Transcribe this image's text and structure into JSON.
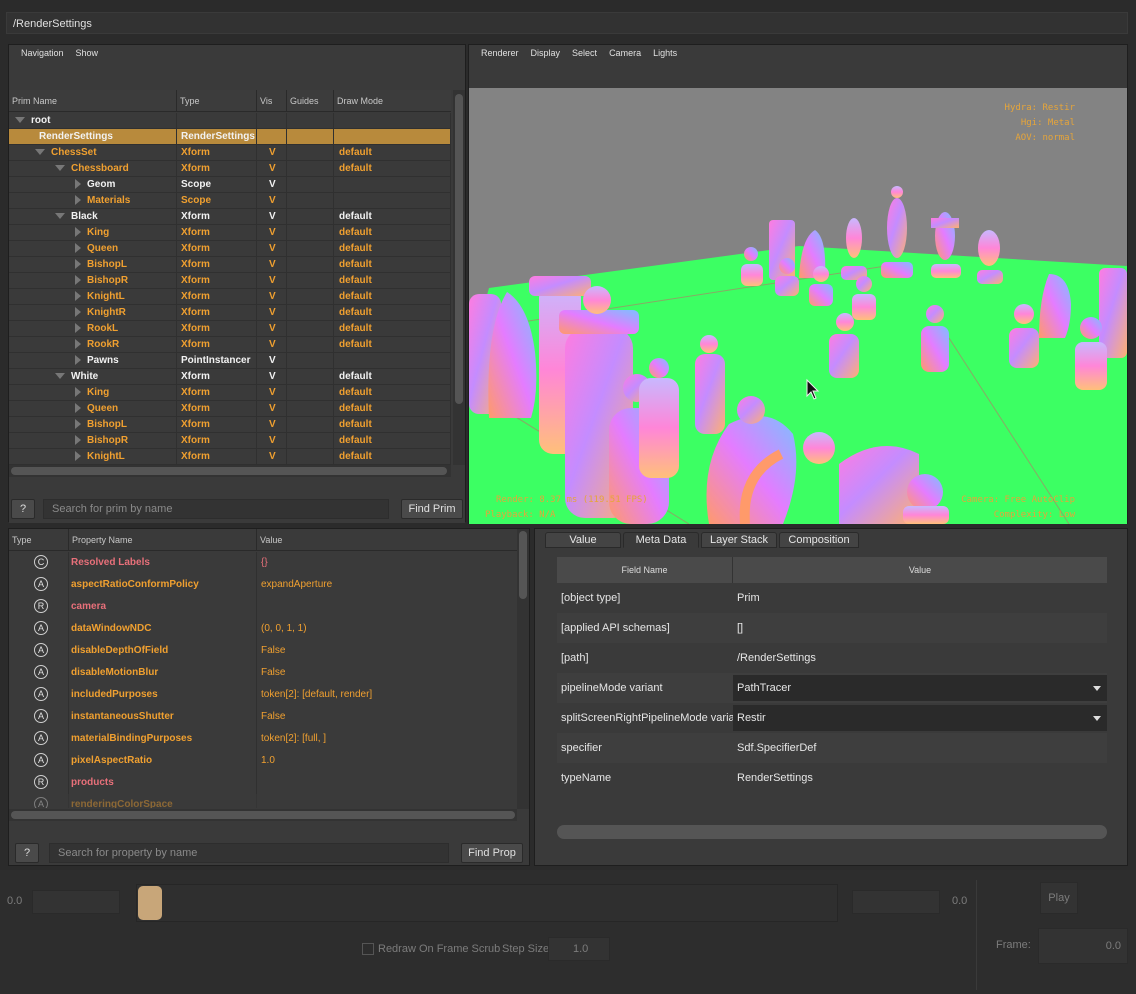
{
  "path": "/RenderSettings",
  "prim_panel": {
    "menu": [
      "Navigation",
      "Show"
    ],
    "columns": [
      "Prim Name",
      "Type",
      "Vis",
      "Guides",
      "Draw Mode"
    ],
    "rows": [
      {
        "name": "root",
        "type": "",
        "vis": "",
        "draw": "",
        "indent": 0,
        "expander": "down",
        "color": "white",
        "selected": false
      },
      {
        "name": "RenderSettings",
        "type": "RenderSettings",
        "vis": "",
        "draw": "",
        "indent": 1,
        "expander": "none",
        "color": "white",
        "selected": true
      },
      {
        "name": "ChessSet",
        "type": "Xform",
        "vis": "V",
        "draw": "default",
        "indent": 1,
        "expander": "down",
        "color": "orange",
        "selected": false
      },
      {
        "name": "Chessboard",
        "type": "Xform",
        "vis": "V",
        "draw": "default",
        "indent": 2,
        "expander": "down",
        "color": "orange",
        "selected": false
      },
      {
        "name": "Geom",
        "type": "Scope",
        "vis": "V",
        "draw": "",
        "indent": 3,
        "expander": "right",
        "color": "white",
        "selected": false
      },
      {
        "name": "Materials",
        "type": "Scope",
        "vis": "V",
        "draw": "",
        "indent": 3,
        "expander": "right",
        "color": "orange",
        "selected": false
      },
      {
        "name": "Black",
        "type": "Xform",
        "vis": "V",
        "draw": "default",
        "indent": 2,
        "expander": "down",
        "color": "white",
        "selected": false
      },
      {
        "name": "King",
        "type": "Xform",
        "vis": "V",
        "draw": "default",
        "indent": 3,
        "expander": "right",
        "color": "orange",
        "selected": false
      },
      {
        "name": "Queen",
        "type": "Xform",
        "vis": "V",
        "draw": "default",
        "indent": 3,
        "expander": "right",
        "color": "orange",
        "selected": false
      },
      {
        "name": "BishopL",
        "type": "Xform",
        "vis": "V",
        "draw": "default",
        "indent": 3,
        "expander": "right",
        "color": "orange",
        "selected": false
      },
      {
        "name": "BishopR",
        "type": "Xform",
        "vis": "V",
        "draw": "default",
        "indent": 3,
        "expander": "right",
        "color": "orange",
        "selected": false
      },
      {
        "name": "KnightL",
        "type": "Xform",
        "vis": "V",
        "draw": "default",
        "indent": 3,
        "expander": "right",
        "color": "orange",
        "selected": false
      },
      {
        "name": "KnightR",
        "type": "Xform",
        "vis": "V",
        "draw": "default",
        "indent": 3,
        "expander": "right",
        "color": "orange",
        "selected": false
      },
      {
        "name": "RookL",
        "type": "Xform",
        "vis": "V",
        "draw": "default",
        "indent": 3,
        "expander": "right",
        "color": "orange",
        "selected": false
      },
      {
        "name": "RookR",
        "type": "Xform",
        "vis": "V",
        "draw": "default",
        "indent": 3,
        "expander": "right",
        "color": "orange",
        "selected": false
      },
      {
        "name": "Pawns",
        "type": "PointInstancer",
        "vis": "V",
        "draw": "",
        "indent": 3,
        "expander": "right",
        "color": "white",
        "selected": false
      },
      {
        "name": "White",
        "type": "Xform",
        "vis": "V",
        "draw": "default",
        "indent": 2,
        "expander": "down",
        "color": "white",
        "selected": false
      },
      {
        "name": "King",
        "type": "Xform",
        "vis": "V",
        "draw": "default",
        "indent": 3,
        "expander": "right",
        "color": "orange",
        "selected": false
      },
      {
        "name": "Queen",
        "type": "Xform",
        "vis": "V",
        "draw": "default",
        "indent": 3,
        "expander": "right",
        "color": "orange",
        "selected": false
      },
      {
        "name": "BishopL",
        "type": "Xform",
        "vis": "V",
        "draw": "default",
        "indent": 3,
        "expander": "right",
        "color": "orange",
        "selected": false
      },
      {
        "name": "BishopR",
        "type": "Xform",
        "vis": "V",
        "draw": "default",
        "indent": 3,
        "expander": "right",
        "color": "orange",
        "selected": false
      },
      {
        "name": "KnightL",
        "type": "Xform",
        "vis": "V",
        "draw": "default",
        "indent": 3,
        "expander": "right",
        "color": "orange",
        "selected": false
      }
    ],
    "search_placeholder": "Search for prim by name",
    "help_label": "?",
    "find_label": "Find Prim"
  },
  "viewport": {
    "menu": [
      "Renderer",
      "Display",
      "Select",
      "Camera",
      "Lights"
    ],
    "hud_top_right": [
      "Hydra: Restir",
      "Hgi: Metal",
      "AOV: normal"
    ],
    "hud_bottom_left": [
      "Render: 8.37 ms (119.51 FPS)",
      "Playback: N/A"
    ],
    "hud_bottom_right": [
      "Camera: Free AutoClip",
      "Complexity: Low"
    ],
    "colors": {
      "background": "#838383",
      "board": "#3cff63",
      "hud": "#e6a53a"
    }
  },
  "property_panel": {
    "columns": [
      "Type",
      "Property Name",
      "Value"
    ],
    "rows": [
      {
        "icon": "C",
        "name": "Resolved Labels",
        "value": "{}",
        "color": "pink"
      },
      {
        "icon": "A",
        "name": "aspectRatioConformPolicy",
        "value": "expandAperture",
        "color": "orange"
      },
      {
        "icon": "R",
        "name": "camera",
        "value": "",
        "color": "pink"
      },
      {
        "icon": "A",
        "name": "dataWindowNDC",
        "value": "(0, 0, 1, 1)",
        "color": "orange"
      },
      {
        "icon": "A",
        "name": "disableDepthOfField",
        "value": "False",
        "color": "orange"
      },
      {
        "icon": "A",
        "name": "disableMotionBlur",
        "value": "False",
        "color": "orange"
      },
      {
        "icon": "A",
        "name": "includedPurposes",
        "value": "token[2]: [default, render]",
        "color": "orange"
      },
      {
        "icon": "A",
        "name": "instantaneousShutter",
        "value": "False",
        "color": "orange"
      },
      {
        "icon": "A",
        "name": "materialBindingPurposes",
        "value": "token[2]: [full, ]",
        "color": "orange"
      },
      {
        "icon": "A",
        "name": "pixelAspectRatio",
        "value": "1.0",
        "color": "orange"
      },
      {
        "icon": "R",
        "name": "products",
        "value": "",
        "color": "pink"
      },
      {
        "icon": "A",
        "name": "renderingColorSpace",
        "value": "",
        "color": "orange"
      }
    ],
    "search_placeholder": "Search for property by name",
    "help_label": "?",
    "find_label": "Find Prop"
  },
  "meta_panel": {
    "tabs": [
      "Value",
      "Meta Data",
      "Layer Stack",
      "Composition"
    ],
    "active_tab": "Meta Data",
    "columns": [
      "Field Name",
      "Value"
    ],
    "rows": [
      {
        "field": "[object type]",
        "value": "Prim",
        "dropdown": false
      },
      {
        "field": "[applied API schemas]",
        "value": "[]",
        "dropdown": false
      },
      {
        "field": "[path]",
        "value": "/RenderSettings",
        "dropdown": false
      },
      {
        "field": "pipelineMode variant",
        "value": "PathTracer",
        "dropdown": true
      },
      {
        "field": "splitScreenRightPipelineMode variant",
        "value": "Restir",
        "dropdown": true
      },
      {
        "field": "specifier",
        "value": "Sdf.SpecifierDef",
        "dropdown": false
      },
      {
        "field": "typeName",
        "value": "RenderSettings",
        "dropdown": false
      }
    ]
  },
  "timeline": {
    "start_value": "0.0",
    "end_value": "0.0",
    "play_label": "Play",
    "redraw_label": "Redraw On Frame Scrub",
    "step_label": "Step Size",
    "step_value": "1.0",
    "frame_label": "Frame:",
    "frame_value": "0.0",
    "slider_position": 0.0
  }
}
